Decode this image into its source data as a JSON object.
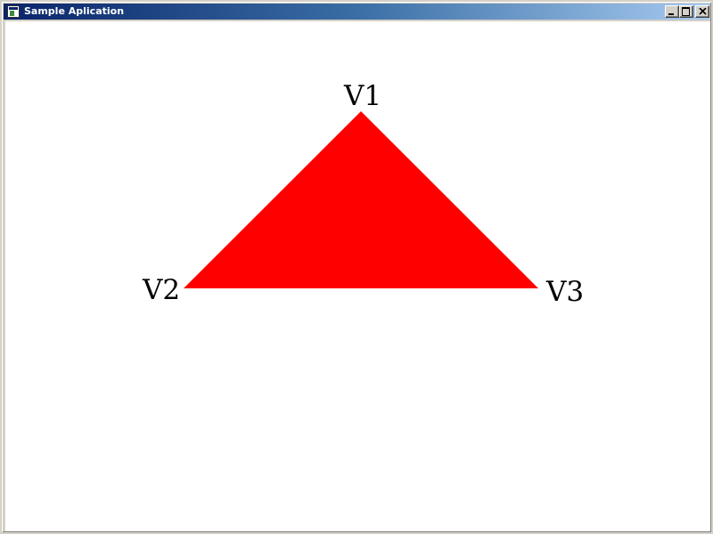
{
  "window": {
    "title": "Sample Aplication"
  },
  "scene": {
    "shape": "triangle",
    "fill_color": "#ff0000",
    "background_color": "#ffffff",
    "vertices": [
      {
        "label": "V1"
      },
      {
        "label": "V2"
      },
      {
        "label": "V3"
      }
    ]
  }
}
